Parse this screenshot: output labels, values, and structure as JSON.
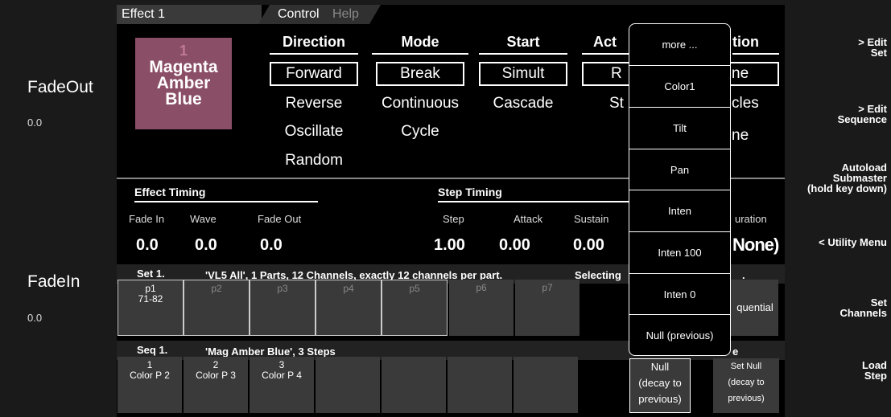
{
  "left_panel": {
    "fadeout_label": "FadeOut",
    "fadeout_value": "0.0",
    "fadein_label": "FadeIn",
    "fadein_value": "0.0"
  },
  "right_panel": [
    {
      "line1": "> Edit",
      "line2": "Set",
      "line3": ""
    },
    {
      "line1": "> Edit",
      "line2": "Sequence",
      "line3": ""
    },
    {
      "line1": "Autoload",
      "line2": "Submaster",
      "line3": "(hold key down)"
    },
    {
      "line1": "< Utility Menu",
      "line2": "",
      "line3": ""
    },
    {
      "line1": "Set",
      "line2": "Channels",
      "line3": ""
    },
    {
      "line1": "Load",
      "line2": "Step",
      "line3": ""
    }
  ],
  "tabs": {
    "effect": "Effect 1",
    "control": "Control",
    "help": "Help"
  },
  "swatch": {
    "number": "1",
    "line1": "Magenta",
    "line2": "Amber",
    "line3": "Blue",
    "color": "#8b4e67"
  },
  "columns": {
    "direction": {
      "header": "Direction",
      "options": [
        "Forward",
        "Reverse",
        "Oscillate",
        "Random"
      ]
    },
    "mode": {
      "header": "Mode",
      "options": [
        "Break",
        "Continuous",
        "Cycle"
      ]
    },
    "start": {
      "header": "Start",
      "options": [
        "Simult",
        "Cascade"
      ]
    },
    "action": {
      "header": "Act",
      "options": [
        "R",
        "St"
      ]
    },
    "duration": {
      "header": "tion",
      "options": [
        "ne",
        "cles",
        "ne"
      ]
    }
  },
  "effect_timing": {
    "title": "Effect Timing",
    "fade_in_label": "Fade In",
    "fade_in": "0.0",
    "wave_label": "Wave",
    "wave": "0.0",
    "fade_out_label": "Fade Out",
    "fade_out": "0.0"
  },
  "step_timing": {
    "title": "Step Timing",
    "step_label": "Step",
    "step": "1.00",
    "attack_label": "Attack",
    "attack": "0.00",
    "sustain_label": "Sustain",
    "sustain": "0.00",
    "duration_label": "uration",
    "duration": "None)"
  },
  "set_bar": {
    "label": "Set 1.",
    "desc": "'VL5 All', 1 Parts, 12 Channels, exactly 12 channels per part.",
    "selecting": "Selecting",
    "dot": "."
  },
  "parts": [
    {
      "name": "p1",
      "range": "71-82"
    },
    {
      "name": "p2",
      "range": ""
    },
    {
      "name": "p3",
      "range": ""
    },
    {
      "name": "p4",
      "range": ""
    },
    {
      "name": "p5",
      "range": ""
    },
    {
      "name": "p6",
      "range": ""
    },
    {
      "name": "p7",
      "range": ""
    }
  ],
  "sequential": "quential",
  "seq_bar": {
    "label": "Seq 1.",
    "desc": "'Mag Amber Blue', 3 Steps",
    "trail": "e"
  },
  "steps": [
    {
      "num": "1",
      "name": "Color P 2"
    },
    {
      "num": "2",
      "name": "Color P 3"
    },
    {
      "num": "3",
      "name": "Color P 4"
    }
  ],
  "null_decay": {
    "line1": "Null",
    "line2": "(decay to",
    "line3": "previous)"
  },
  "set_null": {
    "line1": "Set Null",
    "line2": "(decay to",
    "line3": "previous)"
  },
  "popup_menu": [
    "more ...",
    "Color1",
    "Tilt",
    "Pan",
    "Inten",
    "Inten 100",
    "Inten 0",
    "Null (previous)"
  ]
}
